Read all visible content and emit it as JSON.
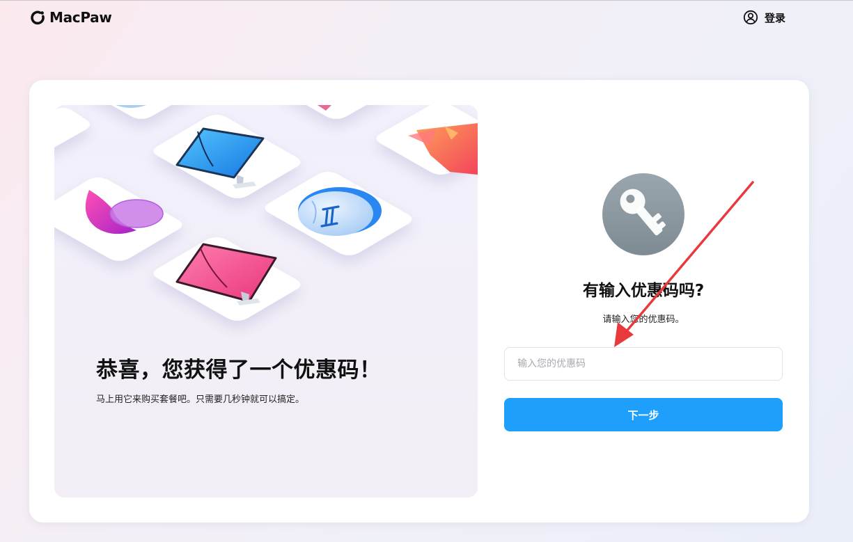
{
  "header": {
    "brand": "MacPaw",
    "login_label": "登录"
  },
  "promo": {
    "title": "恭喜，您获得了一个优惠码！",
    "subtitle": "马上用它来购买套餐吧。只需要几秒钟就可以搞定。"
  },
  "form": {
    "title": "有输入优惠码吗?",
    "subtitle": "请输入您的优惠码。",
    "input_placeholder": "输入您的优惠码",
    "input_value": "",
    "next_button_label": "下一步"
  },
  "icons": {
    "brand": "macpaw-logo-icon",
    "login": "user-circle-icon",
    "key": "key-icon"
  },
  "colors": {
    "accent": "#1e9ffc",
    "annotation": "#e8393d",
    "key_badge": "#8e9aa1"
  }
}
